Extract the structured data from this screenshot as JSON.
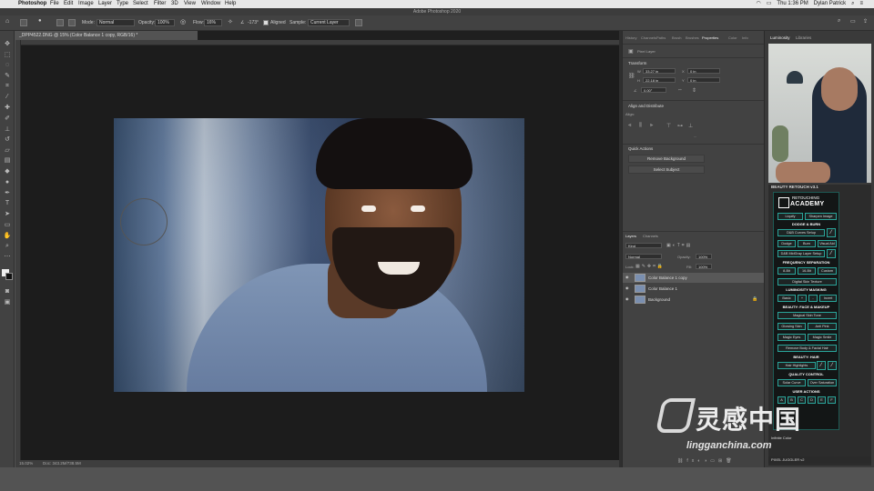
{
  "menubar": {
    "app": "Photoshop",
    "items": [
      "File",
      "Edit",
      "Image",
      "Layer",
      "Type",
      "Select",
      "Filter",
      "3D",
      "View",
      "Window",
      "Help"
    ],
    "clock": "Thu 1:36 PM",
    "user": "Dylan Patrick"
  },
  "window_title": "Adobe Photoshop 2020",
  "options": {
    "mode_label": "Mode:",
    "mode_value": "Normal",
    "opacity_label": "Opacity:",
    "opacity_value": "100%",
    "flow_label": "Flow:",
    "flow_value": "16%",
    "angle_value": "-173°",
    "aligned_label": "Aligned",
    "sample_label": "Sample:",
    "sample_value": "Current Layer"
  },
  "document": {
    "tab_title": "_DPP4522.DNG @ 15% (Color Balance 1 copy, RGB/16) *",
    "zoom": "15.02%",
    "doc_size": "Doc: 343.2M/738.5M"
  },
  "right_panel": {
    "tabs": [
      "History",
      "Channels",
      "Paths",
      "Brush",
      "Brushes",
      "Properties",
      "Color",
      "Info"
    ],
    "pixel_layer_label": "Pixel Layer",
    "transform_title": "Transform",
    "w_label": "W",
    "w_value": "33.27 in",
    "h_label": "H",
    "h_value": "22.18 in",
    "x_label": "X",
    "x_value": "0 in",
    "y_label": "Y",
    "y_value": "0 in",
    "angle_value": "0.00°",
    "align_title": "Align and Distribute",
    "align_label": "Align:",
    "more": "...",
    "quick_title": "Quick Actions",
    "remove_bg": "Remove Background",
    "select_subject": "Select Subject",
    "layers_tab": "Layers",
    "channels_tab": "Channels",
    "kind_label": "Kind",
    "blend_mode": "Normal",
    "opacity_label": "Opacity:",
    "opacity_value": "100%",
    "lock_label": "Lock:",
    "fill_label": "Fill:",
    "fill_value": "100%",
    "layers": [
      "Color Balance 1 copy",
      "Color Balance 1",
      "Background"
    ]
  },
  "far_panel": {
    "tabs": [
      "Luminosity",
      "Libraries"
    ],
    "beauty_title": "BEAUTY RETOUCH v3.1",
    "logo_top": "RETOUCHING",
    "logo_main": "ACADEMY",
    "row1": [
      "Liquify",
      "Sharpen Image"
    ],
    "dodge_title": "DODGE & BURN",
    "db_curves": "D&B Curves Setup",
    "row3": [
      "Dodge",
      "Burn",
      "Visual Aid"
    ],
    "db_midgray": "D&B MidGray Layer Setup",
    "freq_title": "FREQUENCY SEPARATION",
    "freq_row": [
      "8-Bit",
      "16-Bit",
      "Custom"
    ],
    "digital_skin": "Digital Skin Texture",
    "lum_title": "LUMINOSITY MASKING",
    "lum_row": [
      "Basic",
      "+",
      "-",
      "Invert"
    ],
    "face_title": "BEAUTY: FACE & MAKEUP",
    "magical_skin": "Magical Skin Tone",
    "face_row1": [
      "Glowing Skin",
      "Anti Pink"
    ],
    "face_row2": [
      "Magic Eyes",
      "Magic Smile"
    ],
    "remove_hair": "Remove Body & Facial Hair",
    "hair_title": "BEAUTY: HAIR",
    "hair_highlights": "Hair Highlights",
    "quality_title": "QUALITY CONTROL",
    "quality_row": [
      "Solar Curve",
      "Over Saturation"
    ],
    "user_title": "USER ACTIONS",
    "user_row": [
      "A",
      "B",
      "C",
      "D",
      "E",
      "F"
    ],
    "lum_color": "Infinite Color",
    "pixel_juggler": "PIXEL JUGGLER v2"
  },
  "watermark": {
    "cn": "灵感中国",
    "url": "lingganchina.com"
  }
}
